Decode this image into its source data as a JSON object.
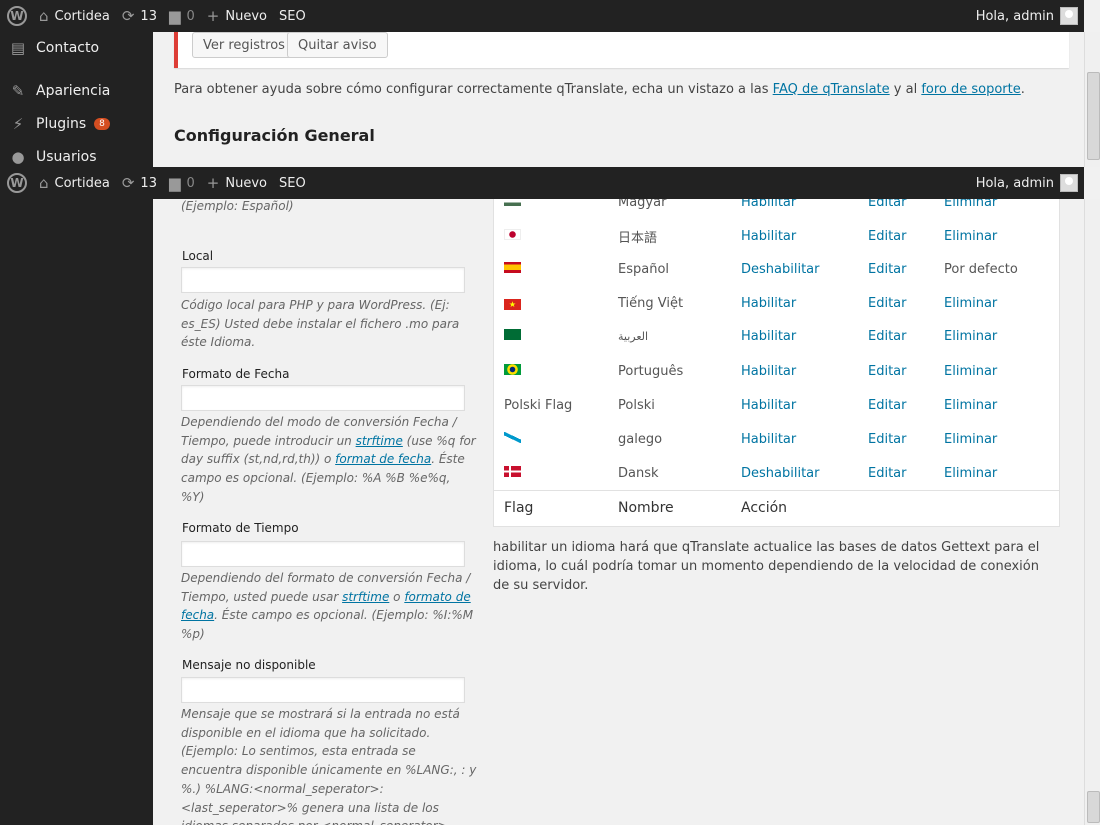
{
  "adminbar": {
    "site_name": "Cortidea",
    "updates_count": "13",
    "comments_count": "0",
    "new_label": "Nuevo",
    "seo_label": "SEO",
    "greeting": "Hola, admin"
  },
  "sidebar_top": {
    "items": [
      {
        "label": "Contacto",
        "icon": "envelope-icon"
      },
      {
        "label": "Apariencia",
        "icon": "paintbrush-icon"
      },
      {
        "label": "Plugins",
        "icon": "plug-icon",
        "badge": "8"
      },
      {
        "label": "Usuarios",
        "icon": "user-icon"
      }
    ]
  },
  "top_panel": {
    "buttons": {
      "view_logs": "Ver registros",
      "dismiss": "Quitar aviso"
    },
    "help": {
      "before": "Para obtener ayuda sobre cómo configurar correctamente qTranslate, echa un vistazo a las ",
      "faq_link": "FAQ de qTranslate",
      "middle": " y al ",
      "forum_link": "foro de soporte",
      "after": "."
    },
    "section_title": "Configuración General"
  },
  "form": {
    "example_top": "(Ejemplo: Español)",
    "local": {
      "label": "Local",
      "desc": "Código local para PHP y para WordPress. (Ej: es_ES) Usted debe instalar el fichero .mo para éste Idioma."
    },
    "date_format": {
      "label": "Formato de Fecha",
      "desc_1": "Dependiendo del modo de conversión Fecha / Tiempo, puede introducir un ",
      "link_1": "strftime",
      "desc_2": " (use %q for day suffix (st,nd,rd,th)) o ",
      "link_2": "format de fecha",
      "desc_3": ". Éste campo es opcional. (Ejemplo: %A %B %e%q, %Y)"
    },
    "time_format": {
      "label": "Formato de Tiempo",
      "desc_1": "Dependiendo del formato de conversión Fecha / Tiempo, usted puede usar ",
      "link_1": "strftime",
      "desc_2": " o ",
      "link_2": "formato de fecha",
      "desc_3": ". Éste campo es opcional. (Ejemplo: %I:%M %p)"
    },
    "not_available": {
      "label": "Mensaje no disponible",
      "desc": "Mensaje que se mostrará si la entrada no está disponible en el idioma que ha solicitado. (Ejemplo: Lo sentimos, esta entrada se encuentra disponible únicamente en %LANG:, : y %.) %LANG:<normal_seperator>:<last_seperator>% genera una lista de los idiomas separados por <normal_seperator> excepto por el último, donde"
    }
  },
  "languages": {
    "rows": [
      {
        "flag": "hu",
        "name": "Magyar",
        "action": "Habilitar",
        "edit": "Editar",
        "delete": "Eliminar"
      },
      {
        "flag": "jp",
        "name": "日本語",
        "action": "Habilitar",
        "edit": "Editar",
        "delete": "Eliminar"
      },
      {
        "flag": "es",
        "name": "Español",
        "action": "Deshabilitar",
        "edit": "Editar",
        "delete": "Por defecto"
      },
      {
        "flag": "vn",
        "name": "Tiếng Việt",
        "action": "Habilitar",
        "edit": "Editar",
        "delete": "Eliminar"
      },
      {
        "flag": "ar",
        "name": "العربية",
        "action": "Habilitar",
        "edit": "Editar",
        "delete": "Eliminar"
      },
      {
        "flag": "br",
        "name": "Português",
        "action": "Habilitar",
        "edit": "Editar",
        "delete": "Eliminar"
      },
      {
        "flag_text": "Polski Flag",
        "name": "Polski",
        "action": "Habilitar",
        "edit": "Editar",
        "delete": "Eliminar"
      },
      {
        "flag": "gl",
        "name": "galego",
        "action": "Habilitar",
        "edit": "Editar",
        "delete": "Eliminar"
      },
      {
        "flag": "dk",
        "name": "Dansk",
        "action": "Deshabilitar",
        "edit": "Editar",
        "delete": "Eliminar"
      }
    ],
    "footer": {
      "flag": "Flag",
      "name": "Nombre",
      "action": "Acción"
    },
    "note": "habilitar un idioma hará que qTranslate actualice las bases de datos Gettext para el idioma, lo cuál podría tomar un momento dependiendo de la velocidad de conexión de su servidor."
  }
}
